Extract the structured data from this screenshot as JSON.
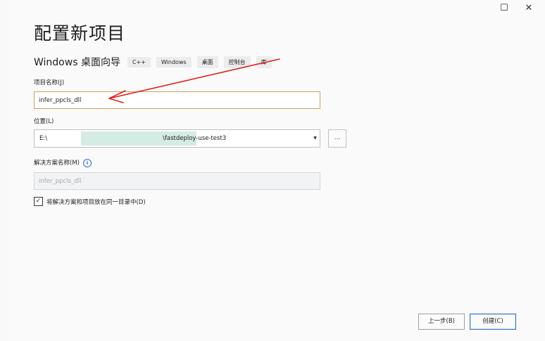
{
  "window": {
    "minimize_icon": "square-outline",
    "close_icon": "x",
    "minimize_glyph": "☐",
    "close_glyph": "✕"
  },
  "page": {
    "title": "配置新项目",
    "subtitle": "Windows 桌面向导",
    "tags": [
      "C++",
      "Windows",
      "桌面",
      "控制台",
      "库"
    ]
  },
  "form": {
    "project_name_label": "项目名称(J)",
    "project_name_value": "infer_ppcls_dll",
    "location_label": "位置(L)",
    "location_prefix": "E:\\",
    "location_suffix": "\\fastdeploy-use-test3",
    "browse_label": "...",
    "solution_name_label": "解决方案名称(M)",
    "solution_name_value": "infer_ppcls_dll",
    "info_glyph": "i",
    "same_dir_checked": true,
    "check_glyph": "✓",
    "same_dir_label": "将解决方案和项目放在同一目录中(D)"
  },
  "footer": {
    "back_label": "上一步(B)",
    "create_label": "创建(C)"
  },
  "annotation": {
    "arrow_color": "#e0201b"
  }
}
